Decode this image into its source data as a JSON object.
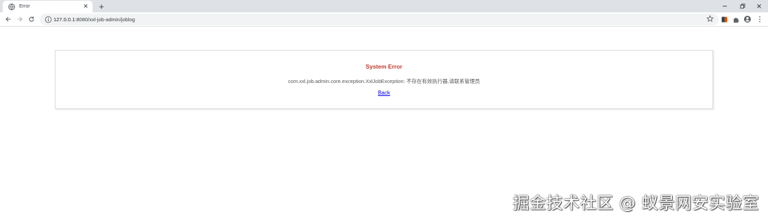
{
  "browser": {
    "tab": {
      "title": "Error",
      "close_glyph": "✕",
      "favicon": "globe-icon"
    },
    "new_tab_glyph": "+",
    "url": {
      "host": "127.0.0.1",
      "rest": ":8080/xxl-job-admin/joblog"
    },
    "icons": [
      "back-arrow-icon",
      "forward-arrow-icon",
      "reload-icon",
      "info-icon",
      "star-icon",
      "extension-icon",
      "puzzle-icon",
      "profile-icon",
      "menu-dots-icon"
    ]
  },
  "error_panel": {
    "title": "System Error",
    "message": "com.xxl.job.admin.core.exception.XxlJobException: 不存在有效执行器,请联系管理员",
    "back_label": "Back"
  },
  "watermark": "掘金技术社区 @ 蚁景网安实验室",
  "colors": {
    "tabstrip": "#dee1e6",
    "title_red": "#c0392b",
    "link_blue": "#0000ee"
  }
}
